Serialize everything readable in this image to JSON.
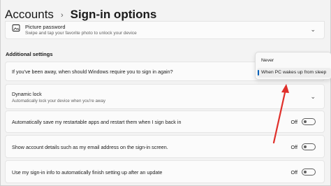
{
  "breadcrumb": {
    "parent": "Accounts",
    "separator": "›",
    "current": "Sign-in options"
  },
  "picture_password": {
    "title": "Picture password",
    "description": "Swipe and tap your favorite photo to unlock your device",
    "icon": "image-icon"
  },
  "additional_settings": {
    "label": "Additional settings",
    "rows": [
      {
        "text": "If you've been away, when should Windows require you to sign in again?"
      },
      {
        "title": "Dynamic lock",
        "description": "Automatically lock your device when you're away"
      },
      {
        "text": "Automatically save my restartable apps and restart them when I sign back in",
        "toggle": "Off",
        "on": false
      },
      {
        "text": "Show account details such as my email address on the sign-in screen.",
        "toggle": "Off",
        "on": false
      },
      {
        "text": "Use my sign-in info to automatically finish setting up after an update",
        "toggle": "Off",
        "on": false
      }
    ]
  },
  "dropdown": {
    "options": [
      "Never",
      "When PC wakes up from sleep"
    ],
    "selected": "When PC wakes up from sleep"
  },
  "colors": {
    "accent": "#005fb8",
    "annotation_arrow": "#e0302b"
  }
}
